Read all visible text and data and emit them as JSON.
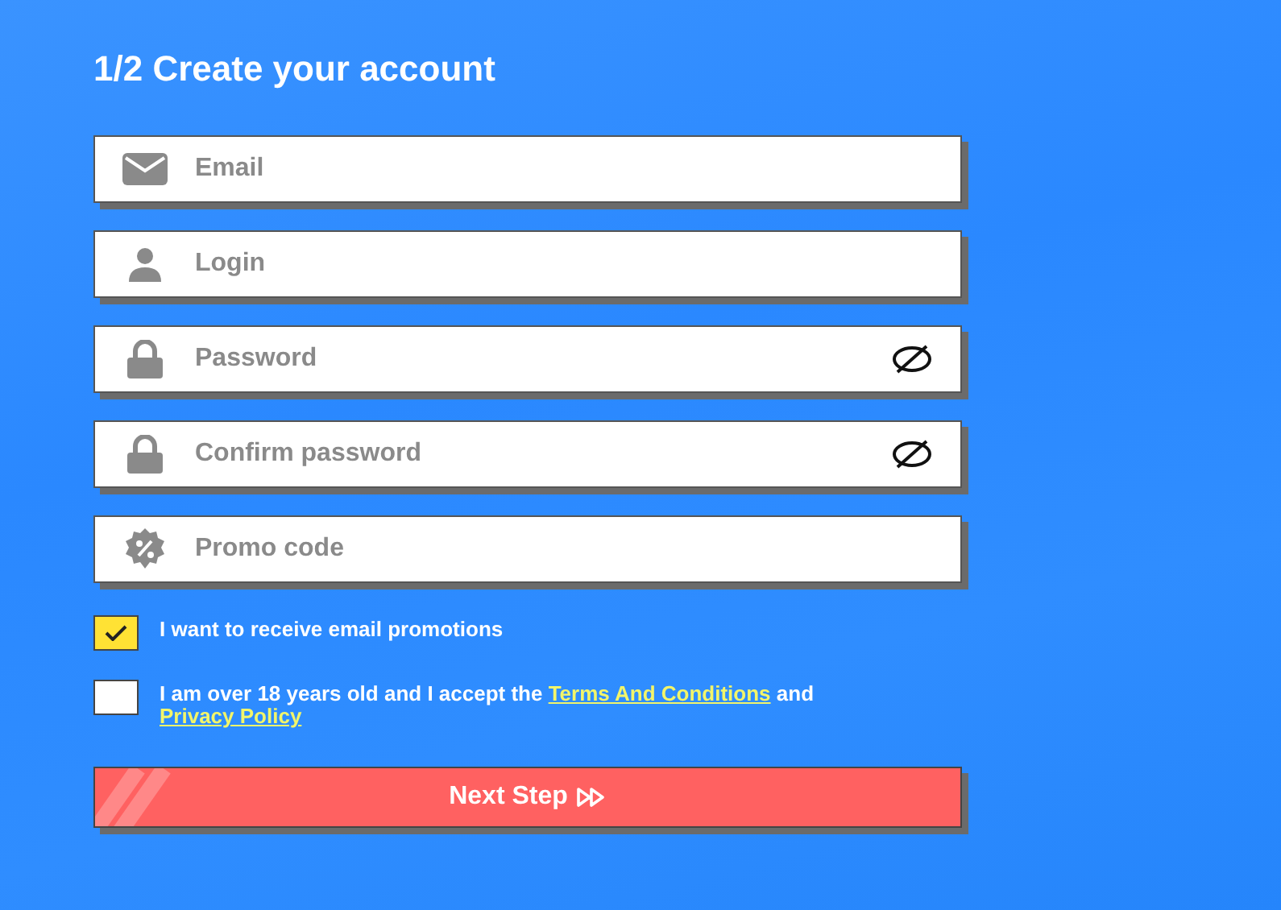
{
  "title": "1/2 Create your account",
  "fields": [
    {
      "kind": "email",
      "placeholder": "Email",
      "reveal_toggle": false
    },
    {
      "kind": "login",
      "placeholder": "Login",
      "reveal_toggle": false
    },
    {
      "kind": "password",
      "placeholder": "Password",
      "reveal_toggle": true
    },
    {
      "kind": "password",
      "placeholder": "Confirm password",
      "reveal_toggle": true
    },
    {
      "kind": "promo",
      "placeholder": "Promo code",
      "reveal_toggle": false
    }
  ],
  "checkboxes": [
    {
      "checked": true,
      "parts": [
        {
          "kind": "text",
          "text": "I want to receive email promotions"
        }
      ]
    },
    {
      "checked": false,
      "parts": [
        {
          "kind": "text",
          "text": "I am over 18 years old and I accept the "
        },
        {
          "kind": "link",
          "text": "Terms And Conditions"
        },
        {
          "kind": "text",
          "text": " and "
        },
        {
          "kind": "link",
          "text": "Privacy Policy"
        }
      ]
    }
  ],
  "submit": {
    "label": "Next Step"
  }
}
